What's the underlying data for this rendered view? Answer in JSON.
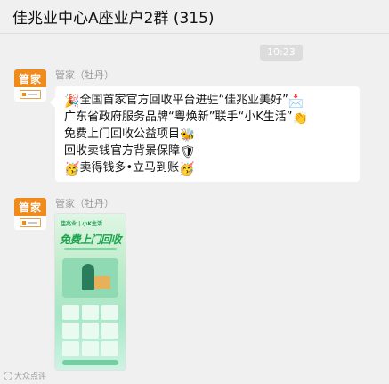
{
  "chat": {
    "title": "佳兆业中心A座业户2群 (315)",
    "timestamp": "10:23"
  },
  "messages": [
    {
      "sender": "管家（牡丹）",
      "avatar_text": "管家",
      "lines": [
        {
          "prefix_icon": "🎉",
          "text": "全国首家官方回收平台进驻“佳兆业美好”",
          "suffix_icon": "📩"
        },
        {
          "prefix_icon": "",
          "text": "广东省政府服务品牌“粤焕新”联手“小K生活”",
          "suffix_icon": "👏"
        },
        {
          "prefix_icon": "",
          "text": "免费上门回收公益项目",
          "suffix_icon": "🐝"
        },
        {
          "prefix_icon": "",
          "text": "回收卖钱官方背景保障",
          "suffix_icon": "🛡"
        },
        {
          "prefix_icon": "🥳",
          "text": "卖得钱多•立马到账",
          "suffix_icon": "🥳"
        }
      ]
    },
    {
      "sender": "管家（牡丹）",
      "avatar_text": "管家",
      "image": {
        "headline": "免费上门回收",
        "brand": "佳兆业 | 小K生活"
      }
    }
  ],
  "watermark": {
    "text": "大众点评",
    "icon": "watermark-logo-icon"
  },
  "colors": {
    "background": "#f0f0f0",
    "avatar": "#f08a1a",
    "bubble": "#ffffff",
    "poster_green": "#1aa34a"
  }
}
